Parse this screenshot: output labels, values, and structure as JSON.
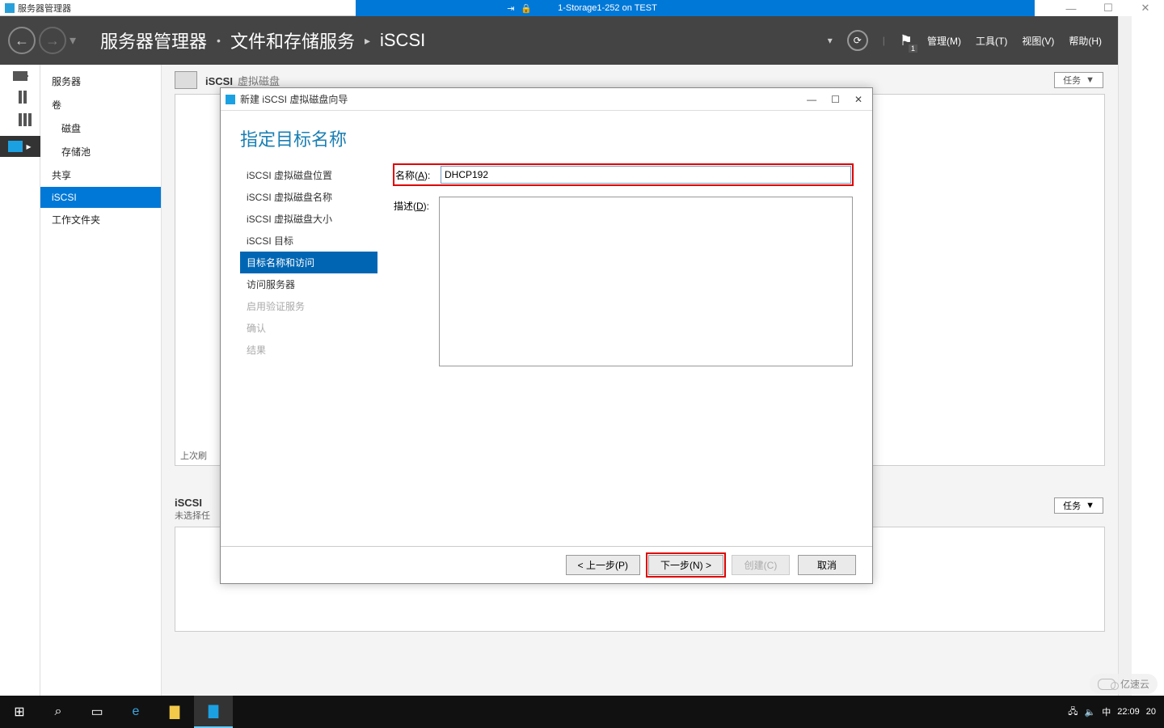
{
  "vm": {
    "title": "1-Storage1-252 on TEST"
  },
  "sm": {
    "window_title": "服务器管理器",
    "breadcrumb": {
      "root": "服务器管理器",
      "sec": "文件和存储服务",
      "leaf": "iSCSI"
    },
    "menus": {
      "manage": "管理(M)",
      "tools": "工具(T)",
      "view": "视图(V)",
      "help": "帮助(H)"
    },
    "flag_badge": "1",
    "sidebar": {
      "servers": "服务器",
      "volumes": "卷",
      "disks": "磁盘",
      "pools": "存储池",
      "shares": "共享",
      "iscsi": "iSCSI",
      "workfolders": "工作文件夹"
    },
    "panel": {
      "title_bold": "iSCSI",
      "title_rest": "虚拟磁盘",
      "tasks": "任务",
      "last_row": "上次刷",
      "sec2_title": "iSCSI",
      "sec2_sub": "未选择任"
    }
  },
  "wizard": {
    "title": "新建 iSCSI 虚拟磁盘向导",
    "heading": "指定目标名称",
    "steps": {
      "loc": "iSCSI 虚拟磁盘位置",
      "name": "iSCSI 虚拟磁盘名称",
      "size": "iSCSI 虚拟磁盘大小",
      "target": "iSCSI 目标",
      "tgt_name": "目标名称和访问",
      "access": "访问服务器",
      "auth": "启用验证服务",
      "confirm": "确认",
      "result": "结果"
    },
    "form": {
      "name_label_pre": "名称(",
      "name_label_u": "A",
      "name_label_post": "):",
      "name_value": "DHCP192",
      "desc_label_pre": "描述(",
      "desc_label_u": "D",
      "desc_label_post": "):"
    },
    "buttons": {
      "prev": "< 上一步(P)",
      "next": "下一步(N) >",
      "create": "创建(C)",
      "cancel": "取消"
    }
  },
  "taskbar": {
    "clock": "22:09",
    "date_suffix": "20",
    "ime": "中"
  },
  "watermark": "亿速云"
}
